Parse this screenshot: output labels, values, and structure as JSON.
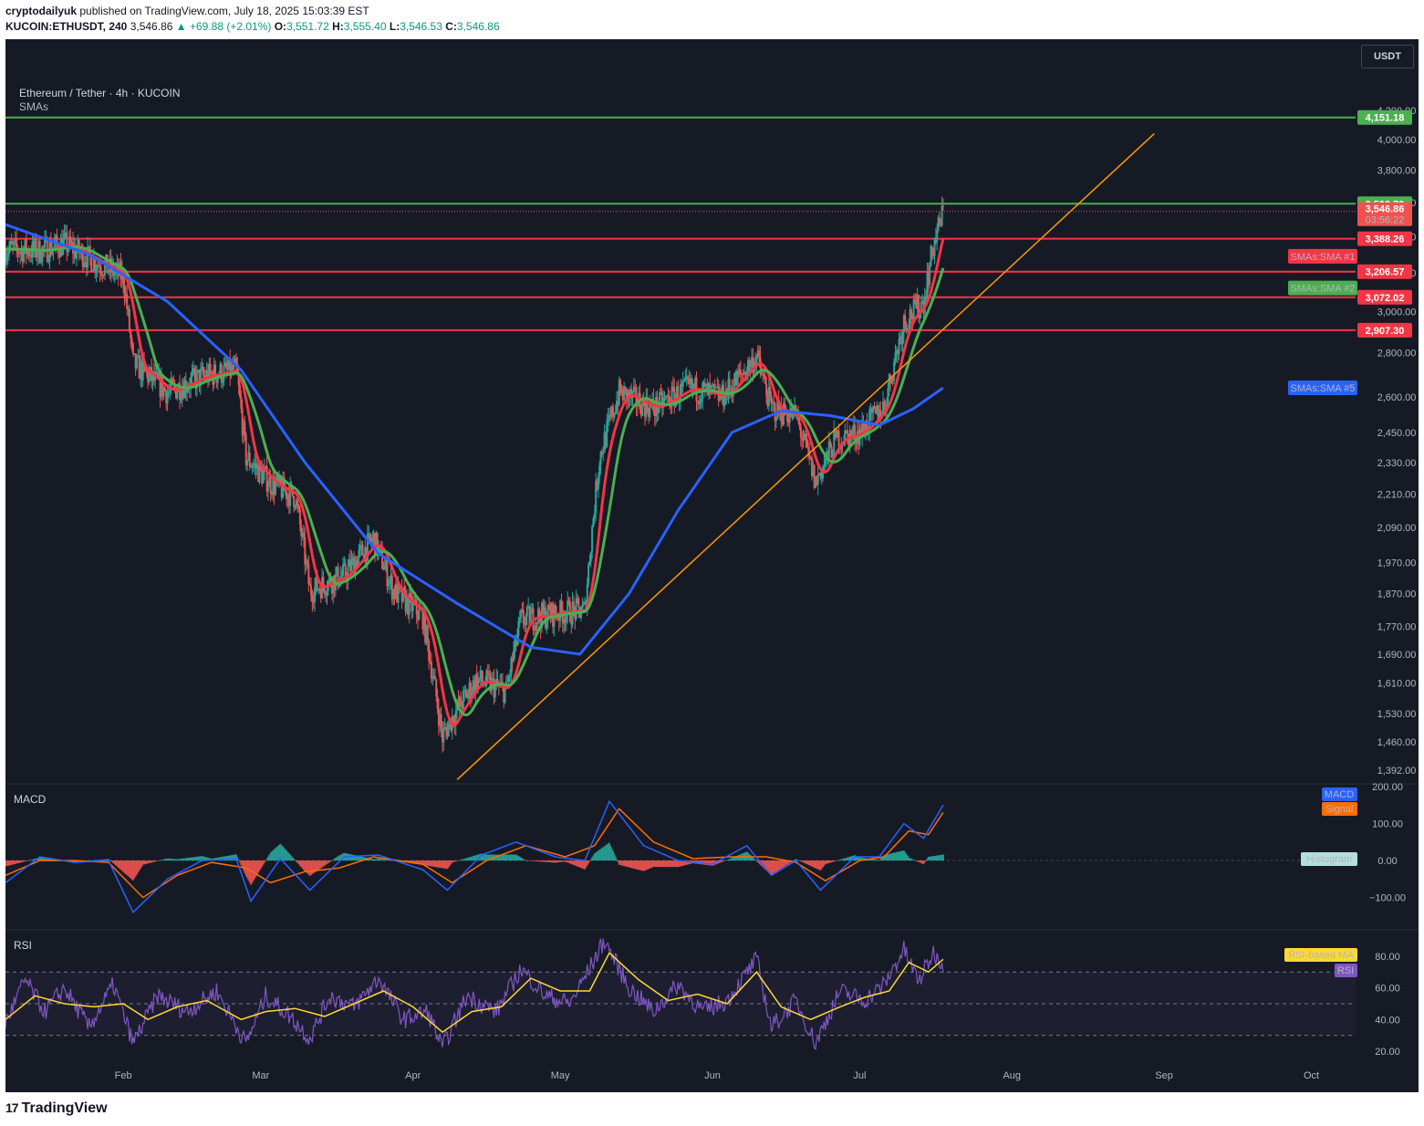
{
  "header": {
    "author": "cryptodailyuk",
    "published_text": "published on TradingView.com, July 18, 2025 15:03:39 EST",
    "symbol": "KUCOIN:ETHUSDT, 240",
    "last": "3,546.86",
    "change": "▲ +69.88 (+2.01%)",
    "o_label": "O:",
    "o": "3,551.72",
    "h_label": "H:",
    "h": "3,555.40",
    "l_label": "L:",
    "l": "3,546.53",
    "c_label": "C:",
    "c": "3,546.86"
  },
  "legend": {
    "title": "Ethereum / Tether · 4h · KUCOIN",
    "indicator": "SMAs"
  },
  "currency_button": "USDT",
  "macd_label": "MACD",
  "rsi_label": "RSI",
  "footer": {
    "logo_mark": "17",
    "logo_text": "TradingView"
  },
  "colors": {
    "background": "#161a25",
    "support_line": "#f23645",
    "resistance_line": "#4caf50",
    "trendline": "#ff9800",
    "sma1": "#f23645",
    "sma2": "#4caf50",
    "sma5": "#2962ff",
    "up": "#26a69a",
    "down": "#ef5350",
    "rsi": "#7e57c2",
    "rsi_ma": "#fdd835",
    "macd": "#2962ff",
    "signal": "#ff6d00"
  },
  "chart_data": [
    {
      "type": "candlestick",
      "title": "Ethereum / Tether · 4h · KUCOIN",
      "x_ticks": [
        "Feb",
        "Mar",
        "Apr",
        "May",
        "Jun",
        "Jul",
        "Aug",
        "Sep",
        "Oct"
      ],
      "x_tick_dates": [
        "2025-02-01",
        "2025-03-01",
        "2025-04-01",
        "2025-05-01",
        "2025-06-01",
        "2025-07-01",
        "2025-08-01",
        "2025-09-01",
        "2025-10-01"
      ],
      "x_range": [
        "2025-01-08",
        "2025-10-10"
      ],
      "y_ticks": [
        "4,200.00",
        "4,000.00",
        "3,800.00",
        "3,600.00",
        "3,400.00",
        "3,200.00",
        "3,000.00",
        "2,800.00",
        "2,600.00",
        "2,450.00",
        "2,330.00",
        "2,210.00",
        "2,090.00",
        "1,970.00",
        "1,870.00",
        "1,770.00",
        "1,690.00",
        "1,610.00",
        "1,530.00",
        "1,460.00",
        "1,392.00"
      ],
      "y_tick_values": [
        4200,
        4000,
        3800,
        3600,
        3400,
        3200,
        3000,
        2800,
        2600,
        2450,
        2330,
        2210,
        2090,
        1970,
        1870,
        1770,
        1690,
        1610,
        1530,
        1460,
        1392
      ],
      "ylim": [
        1370,
        4300
      ],
      "y_scale": "log",
      "price_path": [
        [
          "2025-01-08",
          3330
        ],
        [
          "2025-01-15",
          3320
        ],
        [
          "2025-01-20",
          3360
        ],
        [
          "2025-01-27",
          3250
        ],
        [
          "2025-02-01",
          3180
        ],
        [
          "2025-02-03",
          2750
        ],
        [
          "2025-02-10",
          2620
        ],
        [
          "2025-02-17",
          2690
        ],
        [
          "2025-02-24",
          2720
        ],
        [
          "2025-02-26",
          2350
        ],
        [
          "2025-03-03",
          2250
        ],
        [
          "2025-03-08",
          2200
        ],
        [
          "2025-03-11",
          1880
        ],
        [
          "2025-03-18",
          1930
        ],
        [
          "2025-03-24",
          2050
        ],
        [
          "2025-03-28",
          1880
        ],
        [
          "2025-04-03",
          1800
        ],
        [
          "2025-04-07",
          1470
        ],
        [
          "2025-04-09",
          1520
        ],
        [
          "2025-04-14",
          1620
        ],
        [
          "2025-04-20",
          1590
        ],
        [
          "2025-04-23",
          1790
        ],
        [
          "2025-04-30",
          1810
        ],
        [
          "2025-05-06",
          1820
        ],
        [
          "2025-05-09",
          2350
        ],
        [
          "2025-05-13",
          2620
        ],
        [
          "2025-05-20",
          2550
        ],
        [
          "2025-05-27",
          2640
        ],
        [
          "2025-06-03",
          2600
        ],
        [
          "2025-06-10",
          2780
        ],
        [
          "2025-06-13",
          2550
        ],
        [
          "2025-06-18",
          2520
        ],
        [
          "2025-06-22",
          2250
        ],
        [
          "2025-06-26",
          2420
        ],
        [
          "2025-07-01",
          2450
        ],
        [
          "2025-07-06",
          2560
        ],
        [
          "2025-07-10",
          2950
        ],
        [
          "2025-07-14",
          3050
        ],
        [
          "2025-07-16",
          3350
        ],
        [
          "2025-07-18",
          3546.86
        ]
      ],
      "sma_series": [
        {
          "name": "SMAs:SMA #1",
          "color": "#f23645",
          "last": 3388.26
        },
        {
          "name": "SMAs:SMA #2",
          "color": "#4caf50",
          "last": 3206.57
        },
        {
          "name": "SMAs:SMA #5",
          "color": "#2962ff",
          "last": 2640
        }
      ],
      "sma5_path": [
        [
          "2025-01-08",
          3470
        ],
        [
          "2025-01-25",
          3300
        ],
        [
          "2025-02-10",
          3050
        ],
        [
          "2025-02-25",
          2720
        ],
        [
          "2025-03-10",
          2330
        ],
        [
          "2025-03-25",
          2000
        ],
        [
          "2025-04-10",
          1840
        ],
        [
          "2025-04-25",
          1710
        ],
        [
          "2025-05-05",
          1690
        ],
        [
          "2025-05-15",
          1870
        ],
        [
          "2025-05-25",
          2150
        ],
        [
          "2025-06-05",
          2450
        ],
        [
          "2025-06-15",
          2540
        ],
        [
          "2025-06-25",
          2520
        ],
        [
          "2025-07-05",
          2480
        ],
        [
          "2025-07-12",
          2550
        ],
        [
          "2025-07-18",
          2640
        ]
      ],
      "horizontal_levels": [
        {
          "price": 4151.18,
          "label": "4,151.18",
          "color": "#4caf50"
        },
        {
          "price": 3592.79,
          "label": "3,592.79",
          "color": "#4caf50"
        },
        {
          "price": 3388.26,
          "label": "3,388.26",
          "color": "#f23645"
        },
        {
          "price": 3206.57,
          "label": "3,206.57",
          "color": "#f23645"
        },
        {
          "price": 3072.02,
          "label": "3,072.02",
          "color": "#f23645"
        },
        {
          "price": 2907.3,
          "label": "2,907.30",
          "color": "#f23645"
        }
      ],
      "last_price": {
        "value": 3546.86,
        "label": "3,546.86",
        "countdown": "03:56:22"
      },
      "trendline": [
        [
          "2025-04-10",
          1370
        ],
        [
          "2025-08-30",
          4040
        ]
      ],
      "sma_tags": [
        {
          "text": "SMAs:SMA #1",
          "price": 3290,
          "color": "#f23645"
        },
        {
          "text": "SMAs:SMA #2",
          "price": 3120,
          "color": "#4caf50"
        },
        {
          "text": "SMAs:SMA #5",
          "price": 2640,
          "color": "#2962ff"
        }
      ]
    },
    {
      "type": "line",
      "title": "MACD",
      "y_ticks": [
        "200.00",
        "100.00",
        "0.00",
        "−100.00"
      ],
      "y_tick_values": [
        200,
        100,
        0,
        -100
      ],
      "ylim": [
        -185,
        205
      ],
      "series": [
        {
          "name": "MACD",
          "color": "#2962ff"
        },
        {
          "name": "Signal",
          "color": "#ff6d00"
        },
        {
          "name": "Histogram",
          "color": "#26a69a"
        }
      ],
      "macd_path": [
        [
          "2025-01-08",
          -60
        ],
        [
          "2025-01-15",
          10
        ],
        [
          "2025-01-22",
          -5
        ],
        [
          "2025-01-29",
          0
        ],
        [
          "2025-02-03",
          -140
        ],
        [
          "2025-02-10",
          -50
        ],
        [
          "2025-02-17",
          0
        ],
        [
          "2025-02-24",
          5
        ],
        [
          "2025-02-27",
          -110
        ],
        [
          "2025-03-05",
          5
        ],
        [
          "2025-03-11",
          -80
        ],
        [
          "2025-03-18",
          10
        ],
        [
          "2025-03-25",
          15
        ],
        [
          "2025-04-03",
          -25
        ],
        [
          "2025-04-08",
          -80
        ],
        [
          "2025-04-15",
          15
        ],
        [
          "2025-04-22",
          50
        ],
        [
          "2025-04-30",
          10
        ],
        [
          "2025-05-06",
          0
        ],
        [
          "2025-05-11",
          160
        ],
        [
          "2025-05-18",
          40
        ],
        [
          "2025-05-25",
          0
        ],
        [
          "2025-06-01",
          -10
        ],
        [
          "2025-06-08",
          40
        ],
        [
          "2025-06-13",
          -40
        ],
        [
          "2025-06-18",
          0
        ],
        [
          "2025-06-23",
          -80
        ],
        [
          "2025-06-30",
          10
        ],
        [
          "2025-07-05",
          10
        ],
        [
          "2025-07-10",
          100
        ],
        [
          "2025-07-14",
          60
        ],
        [
          "2025-07-18",
          150
        ]
      ],
      "signal_path": [
        [
          "2025-01-08",
          -40
        ],
        [
          "2025-01-15",
          0
        ],
        [
          "2025-01-22",
          0
        ],
        [
          "2025-01-29",
          -5
        ],
        [
          "2025-02-05",
          -100
        ],
        [
          "2025-02-12",
          -40
        ],
        [
          "2025-02-19",
          -5
        ],
        [
          "2025-02-26",
          -20
        ],
        [
          "2025-03-03",
          -60
        ],
        [
          "2025-03-10",
          -30
        ],
        [
          "2025-03-17",
          -20
        ],
        [
          "2025-03-24",
          10
        ],
        [
          "2025-04-03",
          -10
        ],
        [
          "2025-04-09",
          -60
        ],
        [
          "2025-04-16",
          0
        ],
        [
          "2025-04-24",
          40
        ],
        [
          "2025-05-02",
          10
        ],
        [
          "2025-05-08",
          40
        ],
        [
          "2025-05-13",
          140
        ],
        [
          "2025-05-20",
          50
        ],
        [
          "2025-05-28",
          5
        ],
        [
          "2025-06-05",
          10
        ],
        [
          "2025-06-12",
          10
        ],
        [
          "2025-06-18",
          -5
        ],
        [
          "2025-06-24",
          -55
        ],
        [
          "2025-07-01",
          0
        ],
        [
          "2025-07-06",
          10
        ],
        [
          "2025-07-11",
          80
        ],
        [
          "2025-07-15",
          70
        ],
        [
          "2025-07-18",
          130
        ]
      ]
    },
    {
      "type": "line",
      "title": "RSI",
      "y_ticks": [
        "80.00",
        "60.00",
        "40.00",
        "20.00"
      ],
      "y_tick_values": [
        80,
        60,
        40,
        20
      ],
      "ylim": [
        12,
        96
      ],
      "bands": [
        70,
        50,
        30
      ],
      "series": [
        {
          "name": "RSI-based MA",
          "color": "#fdd835"
        },
        {
          "name": "RSI",
          "color": "#7e57c2"
        }
      ],
      "rsi_path": [
        [
          "2025-01-08",
          38
        ],
        [
          "2025-01-12",
          65
        ],
        [
          "2025-01-16",
          45
        ],
        [
          "2025-01-20",
          60
        ],
        [
          "2025-01-25",
          35
        ],
        [
          "2025-01-30",
          62
        ],
        [
          "2025-02-03",
          25
        ],
        [
          "2025-02-08",
          55
        ],
        [
          "2025-02-14",
          45
        ],
        [
          "2025-02-20",
          58
        ],
        [
          "2025-02-26",
          25
        ],
        [
          "2025-03-02",
          55
        ],
        [
          "2025-03-07",
          42
        ],
        [
          "2025-03-11",
          28
        ],
        [
          "2025-03-15",
          55
        ],
        [
          "2025-03-20",
          48
        ],
        [
          "2025-03-25",
          66
        ],
        [
          "2025-03-30",
          40
        ],
        [
          "2025-04-04",
          45
        ],
        [
          "2025-04-07",
          22
        ],
        [
          "2025-04-12",
          55
        ],
        [
          "2025-04-18",
          45
        ],
        [
          "2025-04-23",
          72
        ],
        [
          "2025-04-28",
          55
        ],
        [
          "2025-05-03",
          50
        ],
        [
          "2025-05-08",
          78
        ],
        [
          "2025-05-10",
          90
        ],
        [
          "2025-05-15",
          60
        ],
        [
          "2025-05-20",
          45
        ],
        [
          "2025-05-25",
          62
        ],
        [
          "2025-05-30",
          45
        ],
        [
          "2025-06-04",
          52
        ],
        [
          "2025-06-10",
          78
        ],
        [
          "2025-06-13",
          35
        ],
        [
          "2025-06-18",
          52
        ],
        [
          "2025-06-22",
          25
        ],
        [
          "2025-06-27",
          58
        ],
        [
          "2025-07-02",
          52
        ],
        [
          "2025-07-06",
          62
        ],
        [
          "2025-07-10",
          84
        ],
        [
          "2025-07-13",
          64
        ],
        [
          "2025-07-16",
          82
        ],
        [
          "2025-07-18",
          75
        ]
      ],
      "rsi_ma_path": [
        [
          "2025-01-08",
          40
        ],
        [
          "2025-01-14",
          55
        ],
        [
          "2025-01-20",
          50
        ],
        [
          "2025-01-26",
          48
        ],
        [
          "2025-02-01",
          50
        ],
        [
          "2025-02-06",
          40
        ],
        [
          "2025-02-12",
          48
        ],
        [
          "2025-02-18",
          52
        ],
        [
          "2025-02-25",
          40
        ],
        [
          "2025-03-02",
          45
        ],
        [
          "2025-03-08",
          47
        ],
        [
          "2025-03-14",
          42
        ],
        [
          "2025-03-20",
          50
        ],
        [
          "2025-03-26",
          58
        ],
        [
          "2025-04-01",
          48
        ],
        [
          "2025-04-07",
          32
        ],
        [
          "2025-04-13",
          45
        ],
        [
          "2025-04-19",
          48
        ],
        [
          "2025-04-25",
          66
        ],
        [
          "2025-05-01",
          58
        ],
        [
          "2025-05-07",
          58
        ],
        [
          "2025-05-11",
          82
        ],
        [
          "2025-05-17",
          65
        ],
        [
          "2025-05-23",
          52
        ],
        [
          "2025-05-29",
          56
        ],
        [
          "2025-06-04",
          50
        ],
        [
          "2025-06-10",
          70
        ],
        [
          "2025-06-15",
          48
        ],
        [
          "2025-06-21",
          40
        ],
        [
          "2025-06-27",
          48
        ],
        [
          "2025-07-02",
          54
        ],
        [
          "2025-07-07",
          58
        ],
        [
          "2025-07-11",
          76
        ],
        [
          "2025-07-15",
          70
        ],
        [
          "2025-07-18",
          78
        ]
      ]
    }
  ]
}
